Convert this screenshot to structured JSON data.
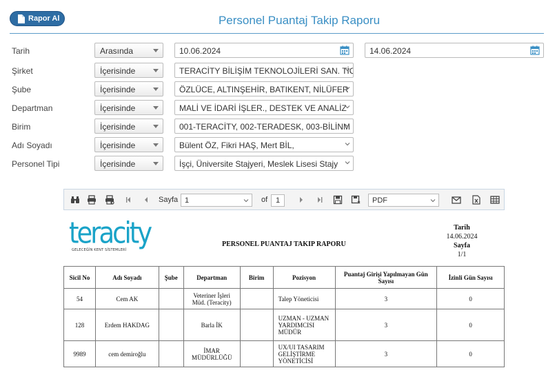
{
  "header": {
    "report_button": "Rapor Al",
    "title": "Personel Puantaj Takip Raporu"
  },
  "filters": [
    {
      "label": "Tarih",
      "operator": "Arasında",
      "date_from": "10.06.2024",
      "date_to": "14.06.2024"
    },
    {
      "label": "Şirket",
      "operator": "İçerisinde",
      "value": "TERACİTY BİLİŞİM TEKNOLOJİLERİ SAN. TİC"
    },
    {
      "label": "Şube",
      "operator": "İçerisinde",
      "value": "ÖZLÜCE, ALTINŞEHİR, BATIKENT, NİLÜFER"
    },
    {
      "label": "Departman",
      "operator": "İçerisinde",
      "value": "MALİ VE İDARİ İŞLER., DESTEK VE ANALİZ"
    },
    {
      "label": "Birim",
      "operator": "İçerisinde",
      "value": "001-TERACİTY, 002-TERADESK, 003-BİLİNM"
    },
    {
      "label": "Adı Soyadı",
      "operator": "İçerisinde",
      "value": "Bülent ÖZ, Fikri HAŞ, Mert BİL,"
    },
    {
      "label": "Personel Tipi",
      "operator": "İçerisinde",
      "value": "İşçi, Üniversite Stajyeri, Meslek Lisesi Stajy"
    }
  ],
  "toolbar": {
    "page_label": "Sayfa",
    "page_value": "1",
    "of_label": "of",
    "total_pages": "1",
    "export_format": "PDF"
  },
  "report": {
    "logo_text": "teracity",
    "logo_tagline": "GELECEĞİN KENT SİSTEMLERİ",
    "title": "PERSONEL PUANTAJ TAKIP RAPORU",
    "date_label": "Tarih",
    "date_value": "14.06.2024",
    "page_label": "Sayfa",
    "page_value": "1/1",
    "columns": [
      "Sicil No",
      "Adı Soyadı",
      "Şube",
      "Departman",
      "Birim",
      "Pozisyon",
      "Puantaj Girişi Yapılmayan Gün Sayısı",
      "İzinli Gün Sayısı"
    ],
    "rows": [
      [
        "54",
        "Cem AK",
        "",
        "Veteriner İşleri Müd. (Teracity)",
        "",
        "Talep Yöneticisi",
        "3",
        "0"
      ],
      [
        "128",
        "Erdem HAKDAG",
        "",
        "Barla İK",
        "",
        "UZMAN - UZMAN YARDIMCISI MÜDÜR",
        "3",
        "0"
      ],
      [
        "9989",
        "cem demiroğlu",
        "",
        "İMAR MÜDÜRLÜĞÜ",
        "",
        "UX/UI TASARIM GELİŞTİRME YÖNETİCİSİ",
        "3",
        "0"
      ]
    ]
  },
  "colors": {
    "accent": "#3a8fc4",
    "button": "#2e6da4",
    "logo": "#1aa3c8"
  }
}
